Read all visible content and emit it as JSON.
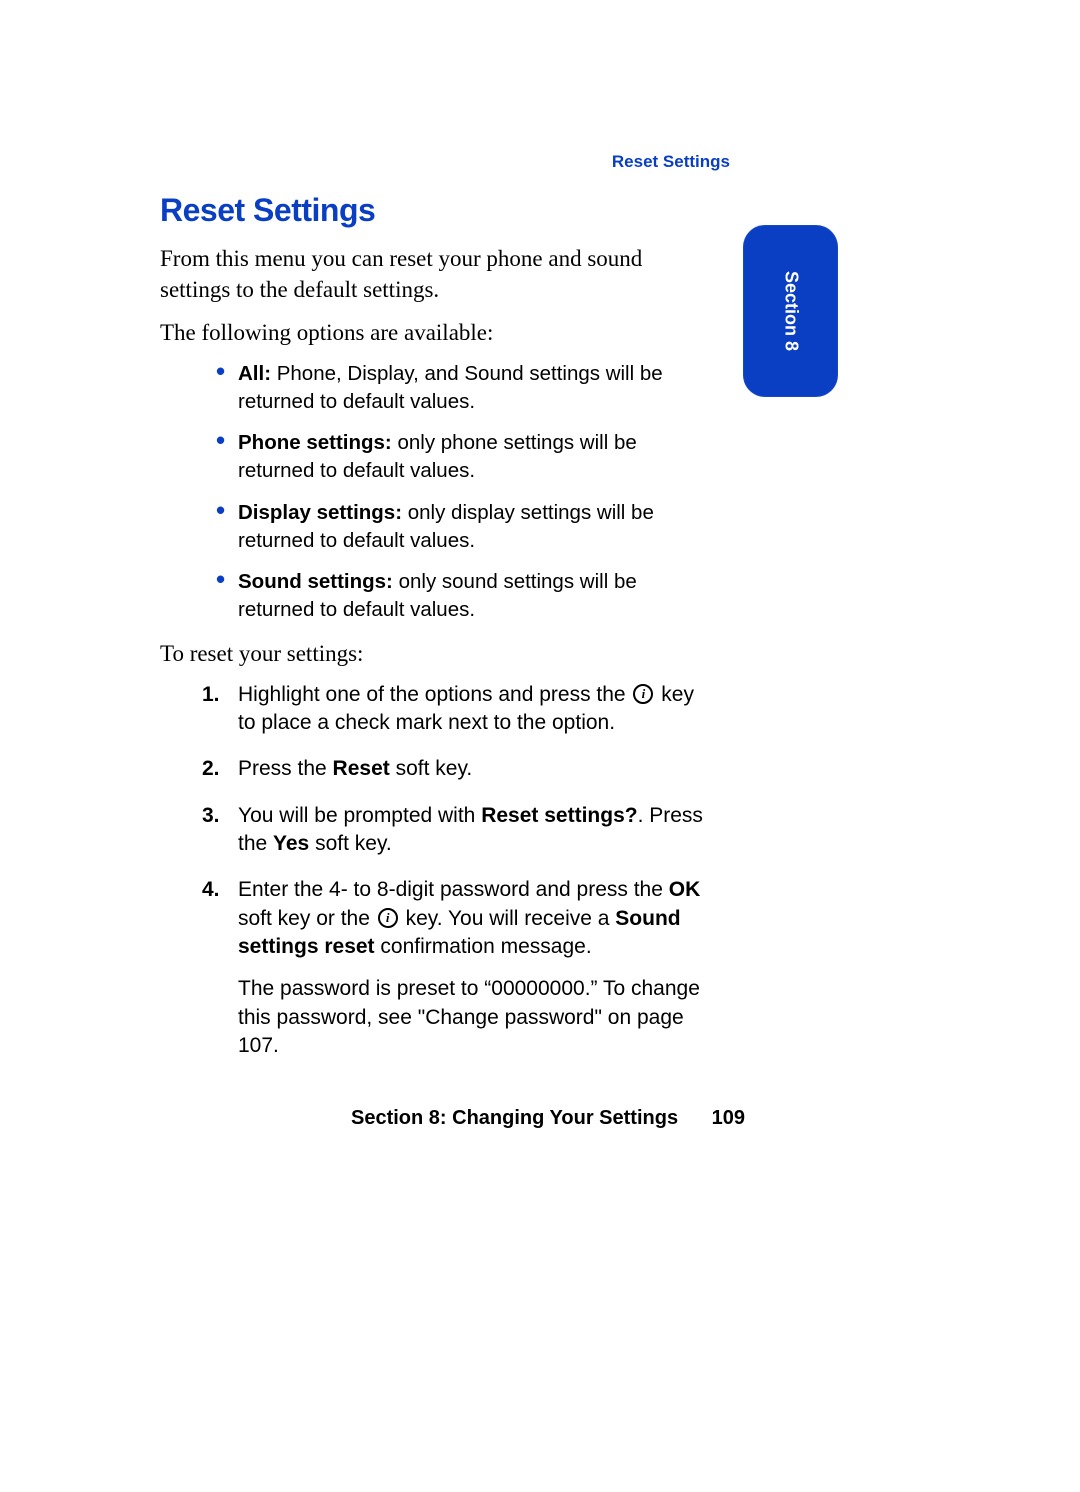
{
  "header": {
    "breadcrumb": "Reset Settings"
  },
  "title": "Reset Settings",
  "intro1": "From this menu you can reset your phone and sound settings to the default settings.",
  "intro2": "The following options are available:",
  "bullets": [
    {
      "label": "All:",
      "text": " Phone, Display, and Sound settings will be returned to default values."
    },
    {
      "label": "Phone settings:",
      "text": " only phone settings will be returned to default values."
    },
    {
      "label": "Display settings:",
      "text": " only display settings will be returned to default values."
    },
    {
      "label": "Sound settings:",
      "text": " only sound settings will be returned to default values."
    }
  ],
  "intro3": "To reset your settings:",
  "steps": {
    "s1": {
      "num": "1.",
      "a": "Highlight one of the options and press the ",
      "b": " key to place a check mark next to the option."
    },
    "s2": {
      "num": "2.",
      "a": "Press the ",
      "bold1": "Reset",
      "b": " soft key."
    },
    "s3": {
      "num": "3.",
      "a": "You will be prompted with ",
      "bold1": "Reset settings?",
      "b": ". Press the ",
      "bold2": "Yes",
      "c": " soft key."
    },
    "s4": {
      "num": "4.",
      "a": "Enter the 4- to 8-digit password and press the ",
      "bold1": "OK",
      "b": " soft key or the ",
      "c": " key. You will receive a ",
      "bold2": "Sound settings reset",
      "d": " confirmation message.",
      "sub": "The password is preset to “00000000.” To change this password, see \"Change password\" on page 107."
    }
  },
  "sidetab": "Section 8",
  "footer": {
    "section": "Section 8: Changing Your Settings",
    "page": "109"
  }
}
